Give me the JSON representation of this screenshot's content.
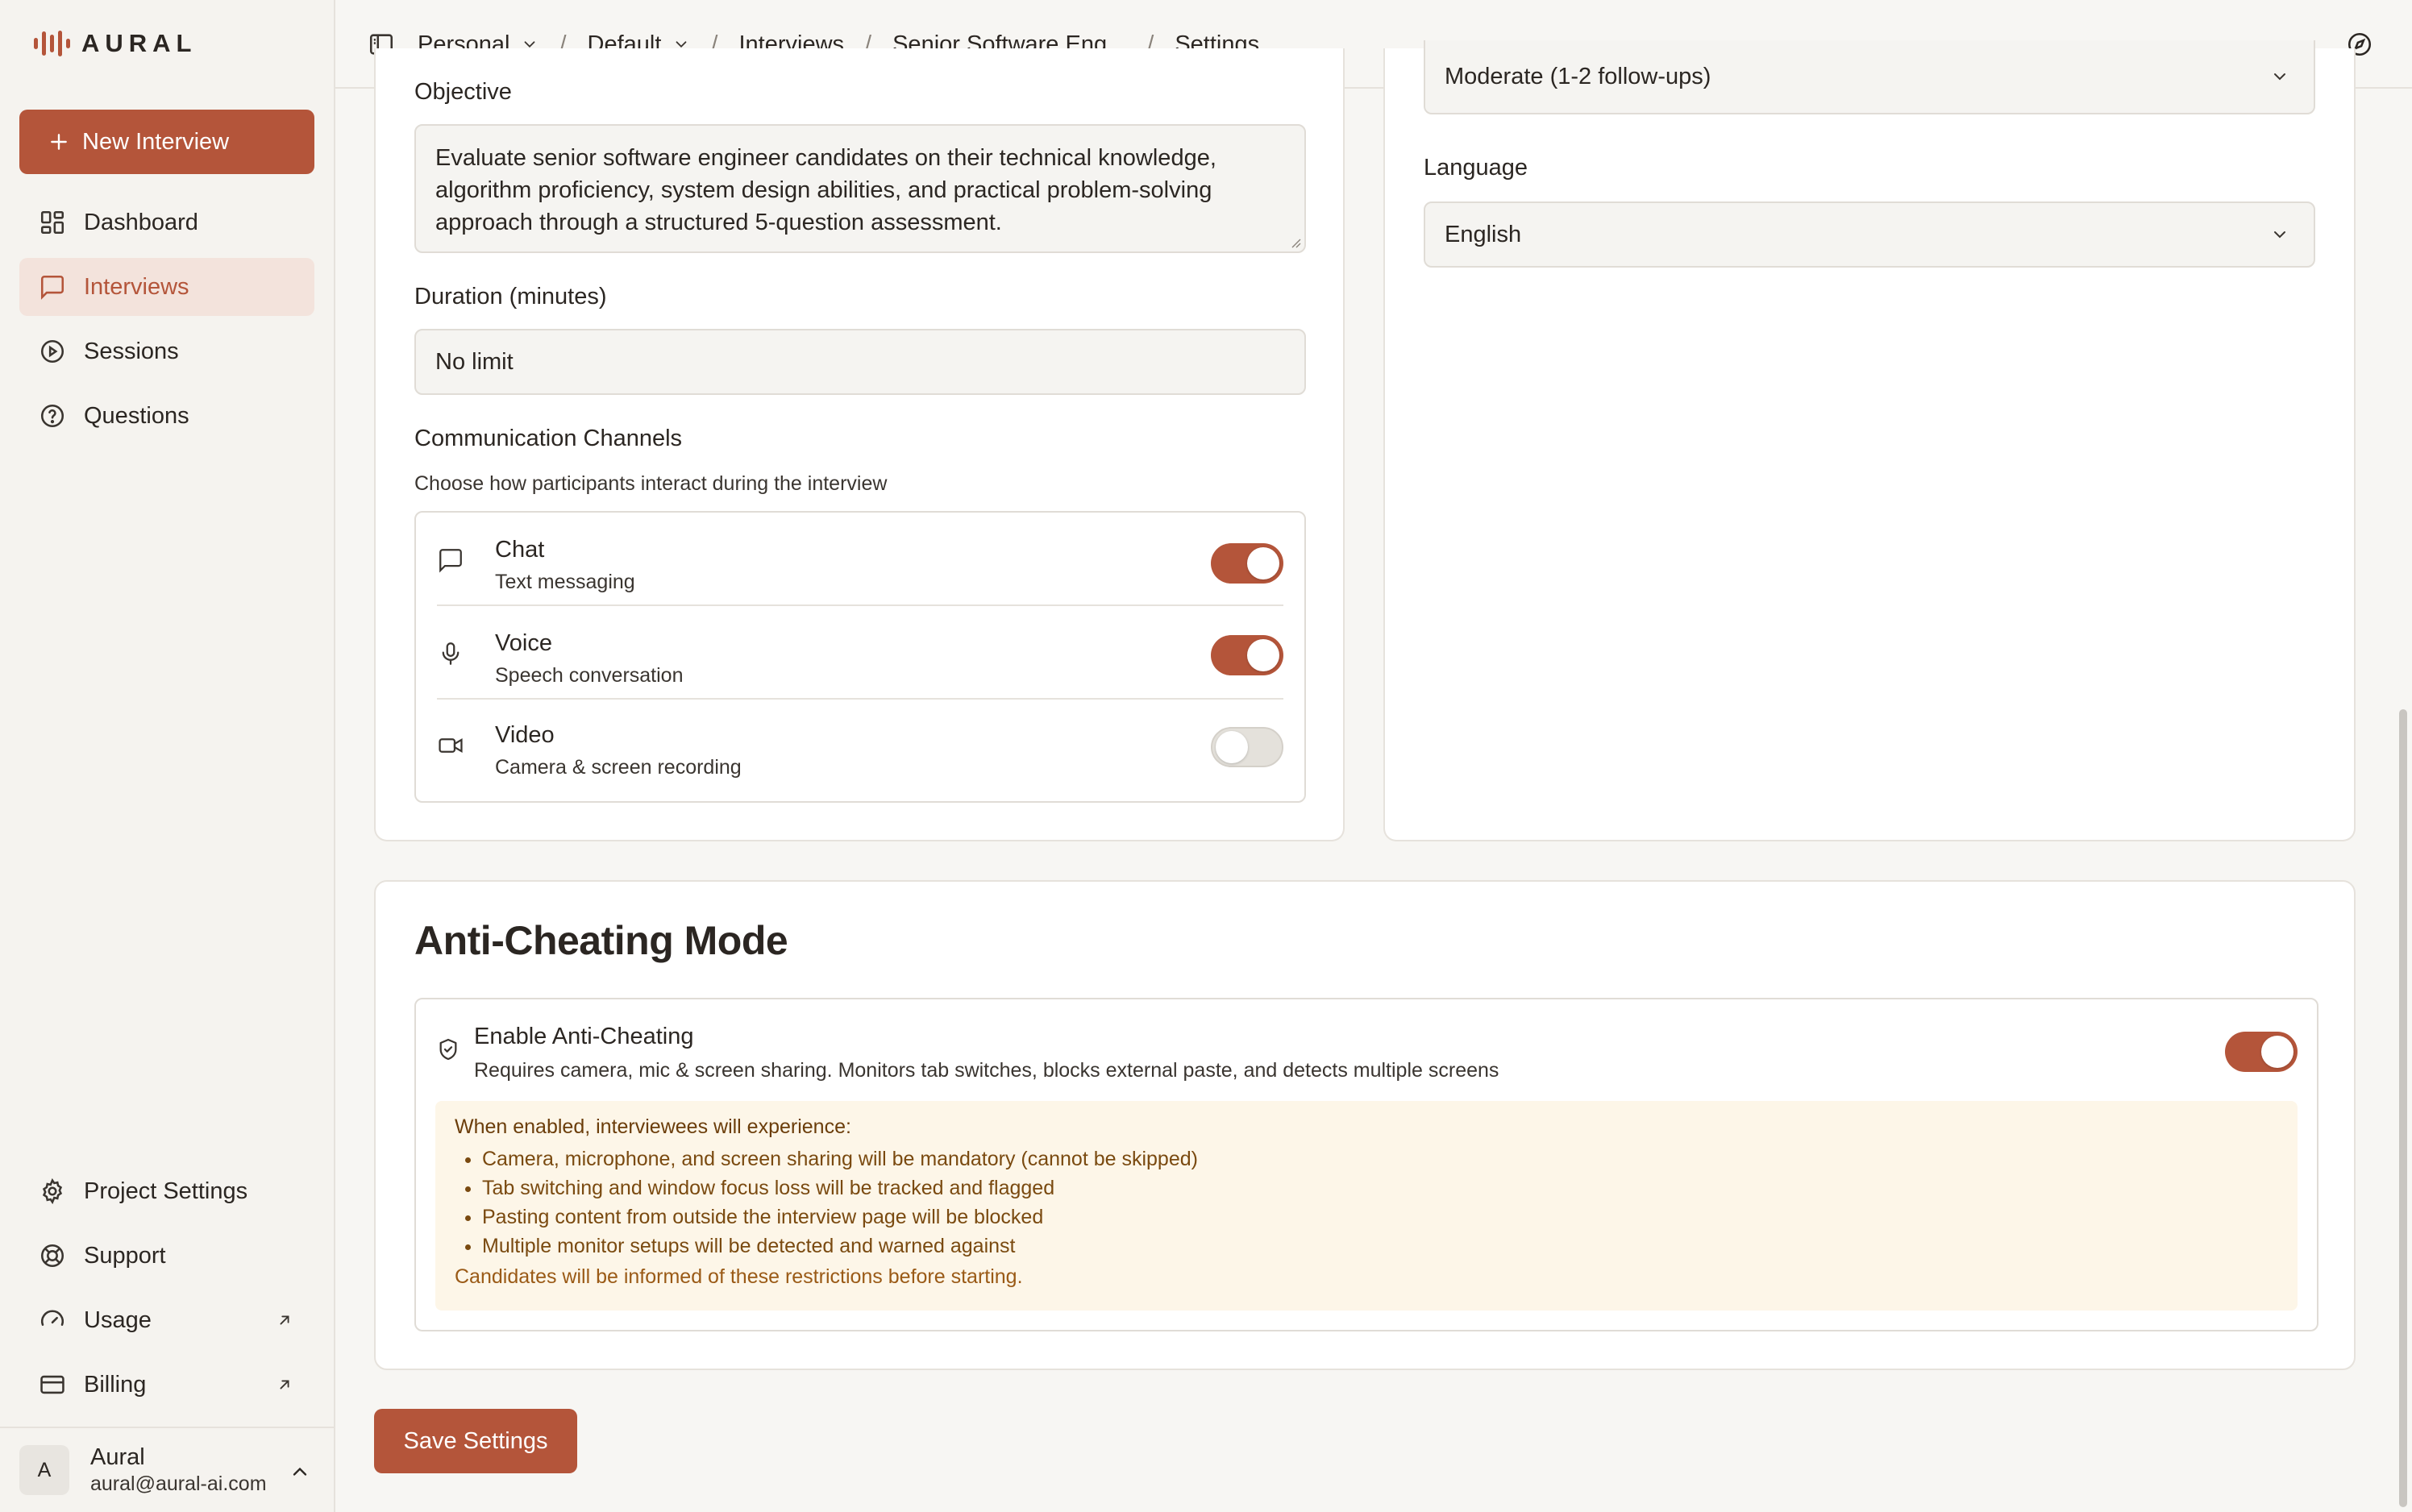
{
  "app": {
    "name": "AURAL"
  },
  "sidebar": {
    "new_button": "New Interview",
    "items": [
      {
        "label": "Dashboard",
        "icon": "dashboard-icon"
      },
      {
        "label": "Interviews",
        "icon": "message-square-icon",
        "active": true
      },
      {
        "label": "Sessions",
        "icon": "play-circle-icon"
      },
      {
        "label": "Questions",
        "icon": "help-circle-icon"
      }
    ],
    "bottom_items": [
      {
        "label": "Project Settings",
        "icon": "gear-icon"
      },
      {
        "label": "Support",
        "icon": "lifebuoy-icon"
      },
      {
        "label": "Usage",
        "icon": "gauge-icon",
        "external": true
      },
      {
        "label": "Billing",
        "icon": "credit-card-icon",
        "external": true
      }
    ],
    "user": {
      "initial": "A",
      "name": "Aural",
      "email": "aural@aural-ai.com"
    }
  },
  "header": {
    "crumbs": [
      "Personal",
      "Default",
      "Interviews",
      "Senior Software Eng...",
      "Settings"
    ]
  },
  "form": {
    "objective_label": "Objective",
    "objective_value": "Evaluate senior software engineer candidates on their technical knowledge, algorithm proficiency, system design abilities, and practical problem-solving approach through a structured 5-question assessment.",
    "duration_label": "Duration (minutes)",
    "duration_value": "No limit",
    "channels_label": "Communication Channels",
    "channels_help": "Choose how participants interact during the interview",
    "channels": [
      {
        "title": "Chat",
        "subtitle": "Text messaging",
        "enabled": true,
        "icon": "message-icon"
      },
      {
        "title": "Voice",
        "subtitle": "Speech conversation",
        "enabled": true,
        "icon": "mic-icon"
      },
      {
        "title": "Video",
        "subtitle": "Camera & screen recording",
        "enabled": false,
        "icon": "video-icon"
      }
    ],
    "followup_value": "Moderate (1-2 follow-ups)",
    "language_label": "Language",
    "language_value": "English"
  },
  "anti_cheating": {
    "heading": "Anti-Cheating Mode",
    "enable_title": "Enable Anti-Cheating",
    "enable_desc": "Requires camera, mic & screen sharing. Monitors tab switches, blocks external paste, and detects multiple screens",
    "enabled": true,
    "notice_title": "When enabled, interviewees will experience:",
    "notice_items": [
      "Camera, microphone, and screen sharing will be mandatory (cannot be skipped)",
      "Tab switching and window focus loss will be tracked and flagged",
      "Pasting content from outside the interview page will be blocked",
      "Multiple monitor setups will be detected and warned against"
    ],
    "notice_footer": "Candidates will be informed of these restrictions before starting."
  },
  "save_button": "Save Settings",
  "colors": {
    "accent": "#b4553a",
    "accent_soft": "#f3e3dc",
    "warning_bg": "#fdf6e8"
  }
}
